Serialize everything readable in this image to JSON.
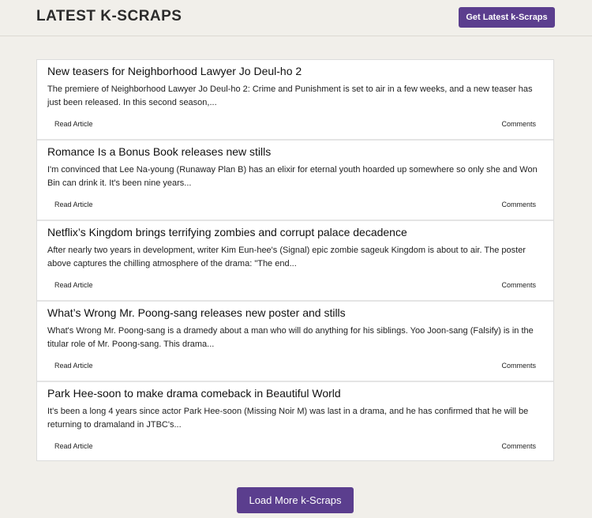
{
  "header": {
    "title": "LATEST K-SCRAPS",
    "get_latest_label": "Get Latest k-Scraps"
  },
  "articles": [
    {
      "title": "New teasers for Neighborhood Lawyer Jo Deul-ho 2",
      "excerpt": "The premiere of Neighborhood Lawyer Jo Deul-ho 2: Crime and Punishment is set to air in a few weeks, and a new teaser has just been released. In this second season,...",
      "read_label": "Read Article",
      "comments_label": "Comments"
    },
    {
      "title": "Romance Is a Bonus Book releases new stills",
      "excerpt": "I'm convinced that Lee Na-young (Runaway Plan B) has an elixir for eternal youth hoarded up somewhere so only she and Won Bin can drink it. It's been nine years...",
      "read_label": "Read Article",
      "comments_label": "Comments"
    },
    {
      "title": "Netflix’s Kingdom brings terrifying zombies and corrupt palace decadence",
      "excerpt": "After nearly two years in development, writer Kim Eun-hee's (Signal) epic zombie sageuk Kingdom is about to air. The poster above captures the chilling atmosphere of the drama: \"The end...",
      "read_label": "Read Article",
      "comments_label": "Comments"
    },
    {
      "title": "What’s Wrong Mr. Poong-sang releases new poster and stills",
      "excerpt": "What's Wrong Mr. Poong-sang is a dramedy about a man who will do anything for his siblings. Yoo Joon-sang (Falsify) is in the titular role of Mr. Poong-sang. This drama...",
      "read_label": "Read Article",
      "comments_label": "Comments"
    },
    {
      "title": "Park Hee-soon to make drama comeback in Beautiful World",
      "excerpt": "It's been a long 4 years since actor Park Hee-soon (Missing Noir M) was last in a drama, and he has confirmed that he will be returning to dramaland in JTBC's...",
      "read_label": "Read Article",
      "comments_label": "Comments"
    }
  ],
  "footer": {
    "load_more_label": "Load More k-Scraps"
  },
  "colors": {
    "accent": "#5b3e8e",
    "background": "#f1efea"
  }
}
